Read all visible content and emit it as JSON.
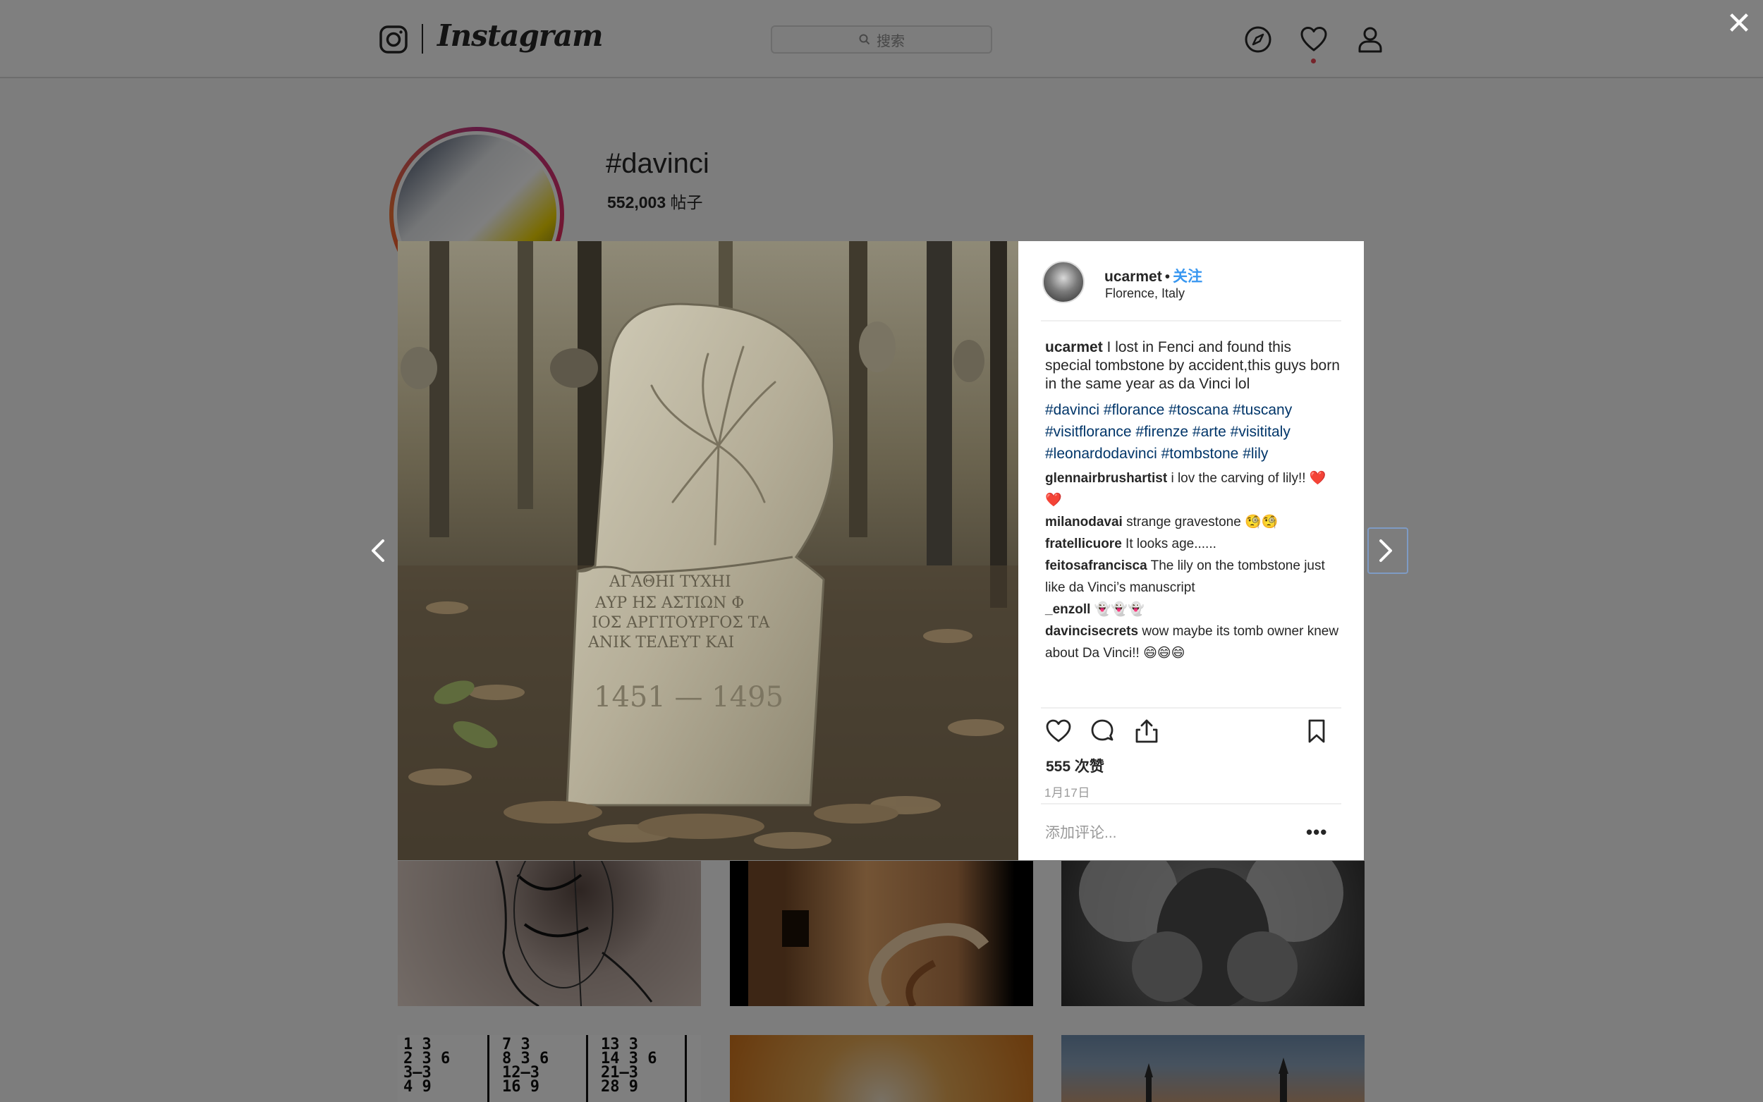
{
  "nav": {
    "wordmark": "Instagram",
    "search_placeholder": "搜索"
  },
  "tag_header": {
    "title": "#davinci",
    "post_count": "552,003",
    "post_unit": "帖子"
  },
  "post": {
    "author": "ucarmet",
    "separator": "•",
    "follow_label": "关注",
    "location": "Florence, Italy",
    "caption_text": "I lost in Fenci and found this special tombstone by accident,this guys born in the same year as da Vinci lol",
    "hashtags": "#davinci #florance #toscana #tuscany #visitflorance #firenze #arte #visititaly #leonardodavinci #tombstone #lily",
    "comments": [
      {
        "user": "glennairbrushartist",
        "text": "i lov the carving of lily!! ❤️❤️"
      },
      {
        "user": "milanodavai",
        "text": "strange gravestone 🧐🧐"
      },
      {
        "user": "fratellicuore",
        "text": "It looks age......"
      },
      {
        "user": "feitosafrancisca",
        "text": "The lily on the tombstone just like da Vinci’s manuscript"
      },
      {
        "user": "_enzoll",
        "text": "👻👻👻"
      },
      {
        "user": "davincisecrets",
        "text": "wow maybe its tomb owner knew about Da Vinci!! 😄😄😄"
      }
    ],
    "likes_count": "555",
    "likes_unit": "次赞",
    "date": "1月17日",
    "add_comment_placeholder": "添加评论...",
    "more_label": "•••"
  },
  "overlay": {
    "close_label": "✕"
  },
  "image": {
    "inscription": [
      "ΑΓΑΘΗΙ ΤΥΧΗΙ",
      "ΑΥΡ ΗΣ ΑΣΤΙΩΝ Φ",
      "ΙΟΣ ΑΡΓΙΤΟΥΡΓΟΣ ΤΑ",
      "ΑΝΙΚ ΤΕΛΕΥΤ ΚΑΙ"
    ],
    "years": "1451 — 1495"
  },
  "colors": {
    "follow": "#3897f0",
    "hashtag": "#003569",
    "notification": "#ed4956"
  }
}
